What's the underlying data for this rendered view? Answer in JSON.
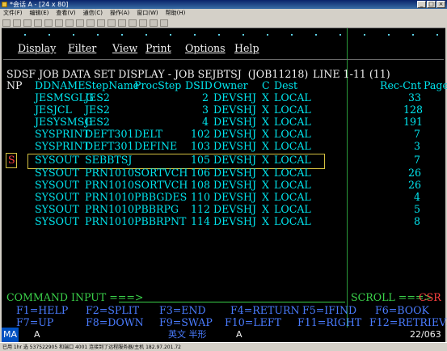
{
  "window": {
    "title": "*会话 A - [24 x 80]"
  },
  "menu": [
    "文件(F)",
    "编辑(E)",
    "查看(V)",
    "通信(C)",
    "操作(A)",
    "窗口(W)",
    "帮助(H)"
  ],
  "sdsf_menu": [
    "Display",
    "Filter",
    "View",
    "Print",
    "Options",
    "Help"
  ],
  "header": {
    "title": "SDSF JOB DATA SET DISPLAY - JOB SEJBTSJ  (JOB11218)",
    "line": "LINE 1-11 (11)"
  },
  "columns": {
    "np": "NP",
    "ddname": "DDNAME",
    "stepname": "StepName",
    "procstep": "ProcStep",
    "dsid": "DSID",
    "owner": "Owner",
    "c": "C",
    "dest": "Dest",
    "reccnt": "Rec-Cnt",
    "page": "Page"
  },
  "rows": [
    {
      "np": "",
      "ddname": "JESMSGLG",
      "stepname": "JES2",
      "procstep": "",
      "dsid": "2",
      "owner": "DEVSHJ",
      "c": "X",
      "dest": "LOCAL",
      "reccnt": "33"
    },
    {
      "np": "",
      "ddname": "JESJCL",
      "stepname": "JES2",
      "procstep": "",
      "dsid": "3",
      "owner": "DEVSHJ",
      "c": "X",
      "dest": "LOCAL",
      "reccnt": "128"
    },
    {
      "np": "",
      "ddname": "JESYSMSG",
      "stepname": "JES2",
      "procstep": "",
      "dsid": "4",
      "owner": "DEVSHJ",
      "c": "X",
      "dest": "LOCAL",
      "reccnt": "191"
    },
    {
      "np": "",
      "ddname": "SYSPRINT",
      "stepname": "DEFT301",
      "procstep": "DELT",
      "dsid": "102",
      "owner": "DEVSHJ",
      "c": "X",
      "dest": "LOCAL",
      "reccnt": "7"
    },
    {
      "np": "",
      "ddname": "SYSPRINT",
      "stepname": "DEFT301",
      "procstep": "DEFINE",
      "dsid": "103",
      "owner": "DEVSHJ",
      "c": "X",
      "dest": "LOCAL",
      "reccnt": "3"
    },
    {
      "np": "S",
      "ddname": "SYSOUT",
      "stepname": "SEBBTSJ",
      "procstep": "",
      "dsid": "105",
      "owner": "DEVSHJ",
      "c": "X",
      "dest": "LOCAL",
      "reccnt": "7"
    },
    {
      "np": "",
      "ddname": "SYSOUT",
      "stepname": "PRN1010",
      "procstep": "SORTVCH",
      "dsid": "106",
      "owner": "DEVSHJ",
      "c": "X",
      "dest": "LOCAL",
      "reccnt": "26"
    },
    {
      "np": "",
      "ddname": "SYSOUT",
      "stepname": "PRN1010",
      "procstep": "SORTVCH",
      "dsid": "108",
      "owner": "DEVSHJ",
      "c": "X",
      "dest": "LOCAL",
      "reccnt": "26"
    },
    {
      "np": "",
      "ddname": "SYSOUT",
      "stepname": "PRN1010",
      "procstep": "PBBGDES",
      "dsid": "110",
      "owner": "DEVSHJ",
      "c": "X",
      "dest": "LOCAL",
      "reccnt": "4"
    },
    {
      "np": "",
      "ddname": "SYSOUT",
      "stepname": "PRN1010",
      "procstep": "PBBRPG",
      "dsid": "112",
      "owner": "DEVSHJ",
      "c": "X",
      "dest": "LOCAL",
      "reccnt": "5"
    },
    {
      "np": "",
      "ddname": "SYSOUT",
      "stepname": "PRN1010",
      "procstep": "PBBRPNT",
      "dsid": "114",
      "owner": "DEVSHJ",
      "c": "X",
      "dest": "LOCAL",
      "reccnt": "8"
    }
  ],
  "command": {
    "label": "COMMAND INPUT ===>",
    "scroll_label": "SCROLL ===>",
    "scroll_value": "CSR"
  },
  "pfkeys_row1": [
    "F1=HELP",
    "F2=SPLIT",
    "F3=END",
    "F4=RETURN",
    "F5=IFIND",
    "F6=BOOK"
  ],
  "pfkeys_row2": [
    "F7=UP",
    "F8=DOWN",
    "F9=SWAP",
    "F10=LEFT",
    "F11=RIGHT",
    "F12=RETRIEVE"
  ],
  "oia": {
    "ma": "MA",
    "a1": "A",
    "ime": "英文 半形",
    "a2": "A",
    "cursor": "22/063"
  },
  "statusbar": {
    "text": "已用 1hr 选 537522905 和端口 4001 连接到了远程服务器/主机 182.97.201.72"
  },
  "colors": {
    "header": "#f0f0f0",
    "field": "#00e5ee",
    "label": "#3ad24a",
    "np_selected": "#ff4040",
    "pf": "#4a7cff"
  }
}
